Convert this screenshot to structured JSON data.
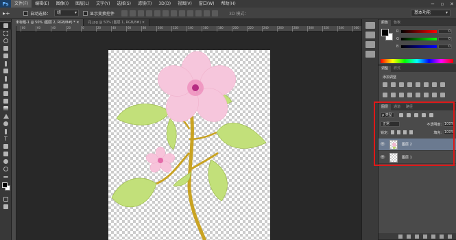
{
  "app": {
    "logo": "Ps"
  },
  "menu": {
    "items": [
      "文件(F)",
      "编辑(E)",
      "图像(I)",
      "图层(L)",
      "文字(Y)",
      "选择(S)",
      "滤镜(T)",
      "3D(D)",
      "视图(V)",
      "窗口(W)",
      "帮助(H)"
    ],
    "active_index": 0
  },
  "window_controls": {
    "minimize": "−",
    "restore": "▫",
    "close": "✕"
  },
  "options_bar": {
    "auto_select_label": "自动选择：",
    "auto_select_value": "组",
    "show_transform_label": "显示变换控件",
    "mode_3d_label": "3D 模式：",
    "workspace": "基本功能"
  },
  "tabs": [
    {
      "label": "未标题-1 @ 50% (图层 2, RGB/8#) * ✕",
      "active": true
    },
    {
      "label": "花.jpg @ 50% (图层 1, RGB/8#) ✕",
      "active": false
    }
  ],
  "ruler": {
    "ticks": [
      "80",
      "60",
      "40",
      "20",
      "0",
      "20",
      "40",
      "60",
      "80",
      "100",
      "120",
      "140",
      "160",
      "180",
      "200",
      "220",
      "240",
      "260",
      "280",
      "300",
      "320",
      "340",
      "360"
    ]
  },
  "color_panel": {
    "tabs": [
      "颜色",
      "色板"
    ],
    "sliders": [
      {
        "label": "R",
        "value": "0",
        "gradient": "linear-gradient(to right,#000,#ff0000)"
      },
      {
        "label": "G",
        "value": "0",
        "gradient": "linear-gradient(to right,#000,#00ff00)"
      },
      {
        "label": "B",
        "value": "0",
        "gradient": "linear-gradient(to right,#000,#0000ff)"
      }
    ]
  },
  "adjustments_panel": {
    "tabs": [
      "调整",
      "样式"
    ],
    "hint": "添加调整"
  },
  "layers_panel": {
    "tabs": [
      "图层",
      "通道",
      "路径"
    ],
    "kind_filter": "ρ 类型",
    "blend_mode": "正常",
    "opacity_label": "不透明度:",
    "opacity_value": "100%",
    "lock_label": "锁定:",
    "fill_label": "填充:",
    "fill_value": "100%",
    "layers": [
      {
        "name": "图层 2",
        "selected": true,
        "thumb": "flower"
      },
      {
        "name": "图层 1",
        "selected": false,
        "thumb": "empty"
      }
    ]
  },
  "colors": {
    "accent_highlight": "#e01818",
    "selected_layer": "#6b7a90"
  }
}
